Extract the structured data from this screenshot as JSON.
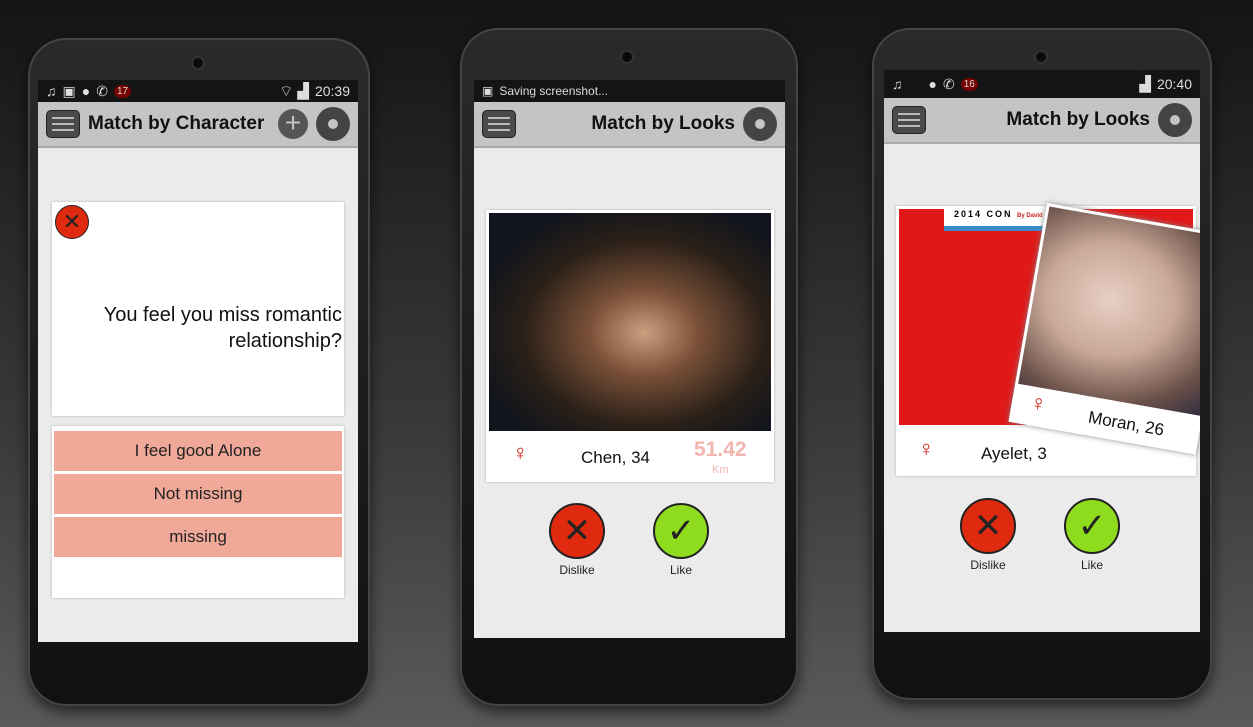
{
  "phone1": {
    "status": {
      "time": "20:39",
      "badge": "17"
    },
    "title": "Match by Character",
    "question": "You feel you miss romantic relationship?",
    "answers": [
      "I feel good Alone",
      "Not missing",
      "missing"
    ]
  },
  "phone2": {
    "status": {
      "notice": "Saving screenshot..."
    },
    "title": "Match by Looks",
    "profile": {
      "name": "Chen, 34",
      "distance": "51.42",
      "unit": "Km"
    },
    "dislike": "Dislike",
    "like": "Like"
  },
  "phone3": {
    "status": {
      "time": "20:40",
      "badge": "16"
    },
    "title": "Match by Looks",
    "back_profile": {
      "name": "Ayelet, 3",
      "banner": "2014 CON",
      "banner_sub": "By David"
    },
    "front_profile": {
      "name": "Moran, 26"
    },
    "dislike": "Dislike",
    "like": "Like"
  },
  "colors": {
    "dislike": "#e02a10",
    "like": "#8fdc1e",
    "answer": "#f0a898",
    "distance": "#f2b4ae"
  }
}
